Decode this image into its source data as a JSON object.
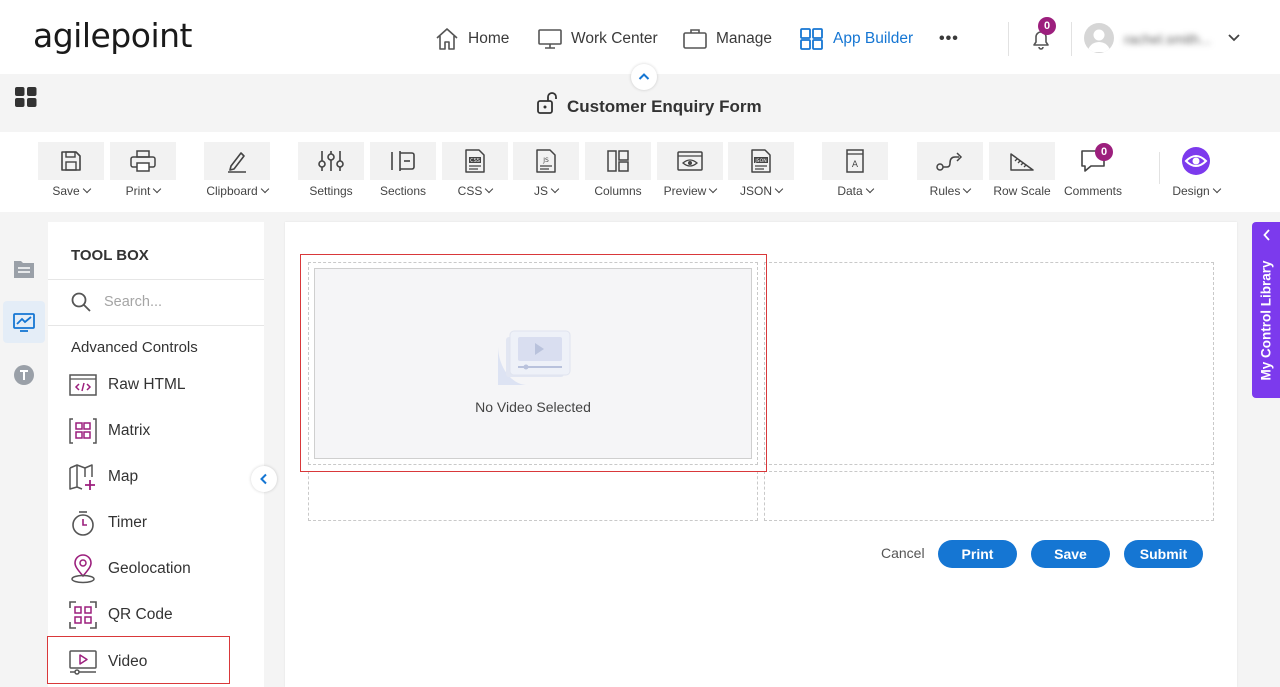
{
  "app": {
    "logo_text": "agilepoint"
  },
  "nav": {
    "home": "Home",
    "work_center": "Work Center",
    "manage": "Manage",
    "app_builder": "App Builder",
    "more": "•••",
    "notification_count": "0",
    "user_name": "rachel.smith..."
  },
  "form": {
    "title": "Customer Enquiry Form"
  },
  "toolbar": {
    "save": "Save",
    "print": "Print",
    "clipboard": "Clipboard",
    "settings": "Settings",
    "sections": "Sections",
    "css": "CSS",
    "js": "JS",
    "columns": "Columns",
    "preview": "Preview",
    "json": "JSON",
    "data": "Data",
    "rules": "Rules",
    "row_scale": "Row Scale",
    "comments": "Comments",
    "comments_count": "0",
    "design": "Design"
  },
  "toolbox": {
    "title": "TOOL BOX",
    "search_placeholder": "Search...",
    "section": "Advanced Controls",
    "items": [
      {
        "label": "Raw HTML",
        "icon": "raw-html-icon"
      },
      {
        "label": "Matrix",
        "icon": "matrix-icon"
      },
      {
        "label": "Map",
        "icon": "map-icon"
      },
      {
        "label": "Timer",
        "icon": "timer-icon"
      },
      {
        "label": "Geolocation",
        "icon": "geolocation-icon"
      },
      {
        "label": "QR Code",
        "icon": "qr-code-icon"
      },
      {
        "label": "Video",
        "icon": "video-icon"
      }
    ]
  },
  "canvas": {
    "video_placeholder": "No Video Selected"
  },
  "form_buttons": {
    "cancel": "Cancel",
    "print": "Print",
    "save": "Save",
    "submit": "Submit"
  },
  "library": {
    "label": "My Control Library"
  },
  "colors": {
    "accent": "#1576d3",
    "badge": "#9c1f7d",
    "library": "#7c3aed",
    "highlight": "#d9383a"
  }
}
